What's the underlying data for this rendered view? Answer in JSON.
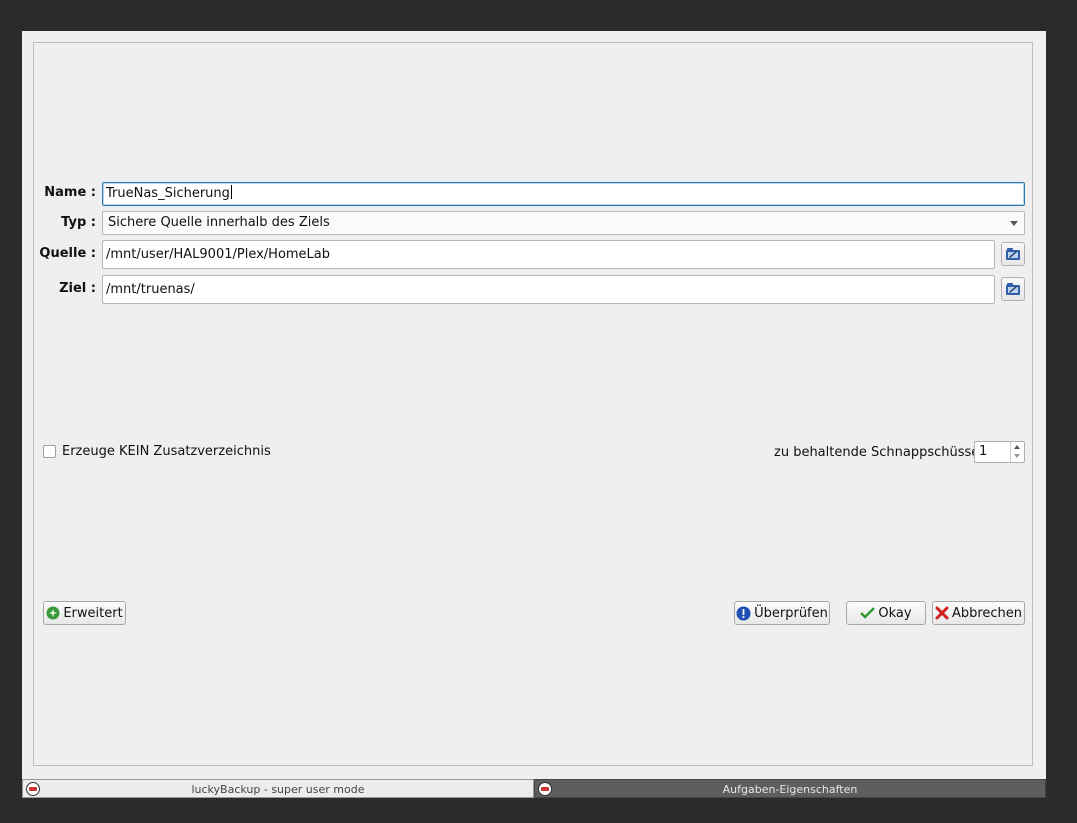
{
  "form": {
    "name_label": "Name :",
    "name_value": "TrueNas_Sicherung",
    "type_label": "Typ :",
    "type_selected": "Sichere Quelle innerhalb des Ziels",
    "source_label": "Quelle :",
    "source_value": "/mnt/user/HAL9001/Plex/HomeLab",
    "dest_label": "Ziel :",
    "dest_value": "/mnt/truenas/"
  },
  "options": {
    "no_extra_dir_label": "Erzeuge KEIN Zusatzverzeichnis",
    "no_extra_dir_checked": false,
    "snapshots_label": "zu behaltende Schnappschüsse:",
    "snapshots_value": "1"
  },
  "buttons": {
    "advanced": "Erweitert",
    "validate": "Überprüfen",
    "okay": "Okay",
    "cancel": "Abbrechen"
  },
  "taskbar": {
    "task1": "luckyBackup - super user mode",
    "task2": "Aufgaben-Eigenschaften"
  },
  "icons": {
    "browse": "folder-browse-icon",
    "advanced": "advanced-icon",
    "validate": "info-icon",
    "okay": "checkmark-icon",
    "cancel": "cross-icon"
  },
  "colors": {
    "background": "#2b2b2b",
    "window": "#efefef",
    "focus": "#2a7ab0",
    "taskbar_active": "#5e5e5e"
  }
}
